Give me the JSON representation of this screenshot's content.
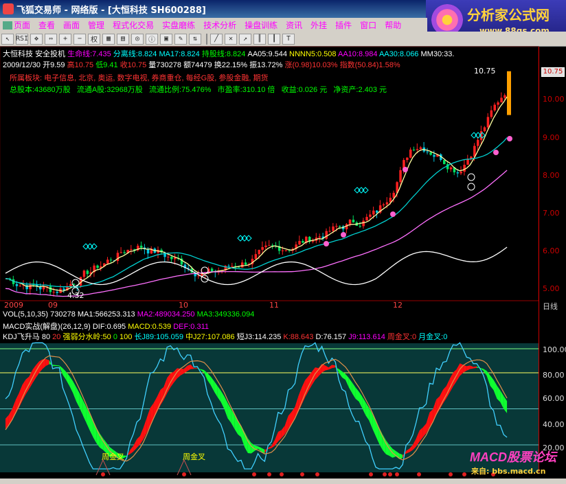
{
  "window": {
    "title": "飞狐交易师 - 网络版 - [大恒科技 SH600288]"
  },
  "brand": {
    "name": "分析家公式网",
    "url": "www.88gs.com"
  },
  "menu": [
    "页面",
    "查看",
    "画面",
    "管理",
    "程式化交易",
    "实盘磨练",
    "技术分析",
    "操盘训练",
    "资讯",
    "外挂",
    "插件",
    "窗口",
    "帮助"
  ],
  "toolbar": {
    "items": [
      "RSI",
      "权"
    ]
  },
  "info": {
    "line1": {
      "stock": "大恒科技",
      "label": "安全投机",
      "life": "生命线:7.435",
      "sep": "分离线:8.824",
      "ma17": "MA17:8.824",
      "hold": "持股线:8.824",
      "aa05": "AA05:9.544",
      "nnnn5": "NNNN5:0.508",
      "aa10": "AA10:8.984",
      "aa30": "AA30:8.066",
      "mm30": "MM30:33."
    },
    "line2": {
      "date": "2009/12/30",
      "open": "开9.59",
      "high": "高10.75",
      "low": "低9.41",
      "close": "收10.75",
      "vol": "量730278",
      "amt": "额74479",
      "turn": "换22.15%",
      "amp": "振13.72%",
      "chg": "涨(0.98)10.03%",
      "idx": "指数(50.84)1.58%"
    },
    "line3": "所属板块: 电子信息, 北京, 奥运, 数字电视, 券商重仓, 每经G股, 参股金融, 期货",
    "line4": {
      "total": "总股本:43680万股",
      "float": "流通A股:32968万股",
      "ratio": "流通比例:75.476%",
      "pe": "市盈率:310.10 倍",
      "eps": "收益:0.026 元",
      "nav": "净资产:2.403 元"
    }
  },
  "price_axis": {
    "labels": [
      "10.00",
      "9.00",
      "8.00",
      "7.00",
      "6.00",
      "5.00"
    ],
    "current": "10.75",
    "top_label": "10.75",
    "low_label": "4.32"
  },
  "dates": [
    "2009",
    "09",
    "10",
    "11",
    "12",
    "日线"
  ],
  "vol_line": {
    "name": "VOL(5,10,35)",
    "val": "730278",
    "ma1": "MA1:566253.313",
    "ma2": "MA2:489034.250",
    "ma3": "MA3:349336.094"
  },
  "macd_line": {
    "name": "MACD实战(解盘)(26,12,9)",
    "dif": "DIF:0.695",
    "macd": "MACD:0.539",
    "def": "DEF:0.311"
  },
  "kdj_line": {
    "name": "KDJ飞升马",
    "p1": "80",
    "p2": "20",
    "strong": "强弱分水岭:50",
    "p3": "0",
    "p4": "100",
    "long": "长J89:105.059",
    "mid": "中J27:107.086",
    "short": "短J3:114.235",
    "k": "K:88.643",
    "d": "D:76.157",
    "j9": "J9:113.614",
    "week": "周金叉:0",
    "month": "月金叉:0"
  },
  "kdj_axis": [
    "100.00",
    "80.00",
    "60.00",
    "40.00",
    "20.00"
  ],
  "kdj_tags": [
    "周金叉",
    "周金叉"
  ],
  "watermark": {
    "logo": "MACD股票论坛",
    "url": "来自: bbs.macd.cn"
  },
  "colors": {
    "up": "#ff2020",
    "down": "#00e0e0",
    "bg": "#000000",
    "title": "#0a246a"
  }
}
